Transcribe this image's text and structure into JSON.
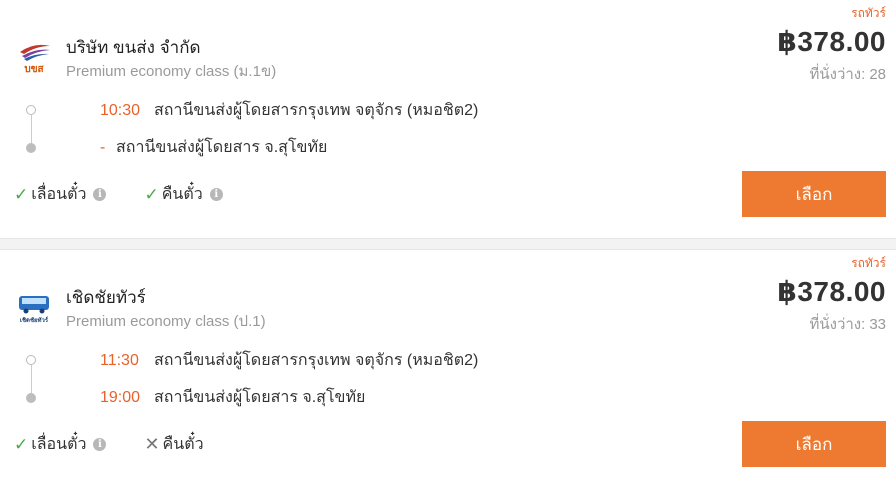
{
  "results": [
    {
      "tag": "รถทัวร์",
      "company": "บริษัท ขนส่ง จำกัด",
      "bus_class": "Premium economy class (ม.1ข)",
      "price": "฿378.00",
      "seats_label": "ที่นั่งว่าง:",
      "seats_count": "28",
      "departure_time": "10:30",
      "departure_station": "สถานีขนส่งผู้โดยสารกรุงเทพ จตุจักร (หมอชิต2)",
      "arrival_time": "-",
      "arrival_station": "สถานีขนส่งผู้โดยสาร จ.สุโขทัย",
      "policy_change": "เลื่อนตั๋ว",
      "policy_change_status": "check",
      "policy_refund": "คืนตั๋ว",
      "policy_refund_status": "check",
      "select_label": "เลือก",
      "logo_text": "บขส"
    },
    {
      "tag": "รถทัวร์",
      "company": "เชิดชัยทัวร์",
      "bus_class": "Premium economy class (ป.1)",
      "price": "฿378.00",
      "seats_label": "ที่นั่งว่าง:",
      "seats_count": "33",
      "departure_time": "11:30",
      "departure_station": "สถานีขนส่งผู้โดยสารกรุงเทพ จตุจักร (หมอชิต2)",
      "arrival_time": "19:00",
      "arrival_station": "สถานีขนส่งผู้โดยสาร จ.สุโขทัย",
      "policy_change": "เลื่อนตั๋ว",
      "policy_change_status": "check",
      "policy_refund": "คืนตั๋ว",
      "policy_refund_status": "cross",
      "select_label": "เลือก",
      "logo_text": "เชิดชัยทัวร์"
    }
  ],
  "colors": {
    "accent": "#ee7a32",
    "time": "#e8622a",
    "check": "#4aa84a",
    "muted": "#9a9a9a"
  }
}
